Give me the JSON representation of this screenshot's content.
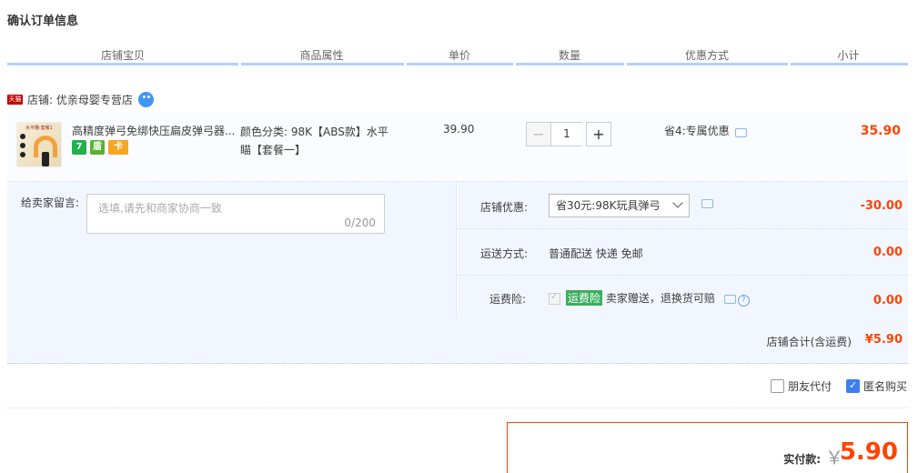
{
  "title": "确认订单信息",
  "columns": [
    "店铺宝贝",
    "商品属性",
    "单价",
    "数量",
    "优惠方式",
    "小计"
  ],
  "shop": {
    "badge": "天猫",
    "label": "店铺: 优亲母婴专营店"
  },
  "item": {
    "thumb_label": "水平瞄·套餐1",
    "title": "高精度弹弓免绑快压扁皮弹弓器...",
    "badges": [
      "7",
      "盾",
      "卡"
    ],
    "attr_line1": "颜色分类: 98K【ABS款】水平",
    "attr_line2": "瞄【套餐一】",
    "price": "39.90",
    "quantity": "1",
    "promo": "省4:专属优惠",
    "subtotal": "35.90"
  },
  "message": {
    "label": "给卖家留言:",
    "placeholder": "选填,请先和商家协商一致",
    "count": "0/200"
  },
  "shop_discount": {
    "label": "店铺优惠:",
    "selected": "省30元:98K玩具弹弓",
    "amount": "-30.00"
  },
  "shipping": {
    "label": "运送方式:",
    "text": "普通配送 快递 免邮",
    "amount": "0.00"
  },
  "insurance": {
    "label": "运费险:",
    "badge": "运费险",
    "text": "卖家赠送，退换货可赔",
    "help": "?",
    "amount": "0.00"
  },
  "shop_total": {
    "label": "店铺合计(含运费)",
    "amount": "¥5.90"
  },
  "options": {
    "friend_pay": "朋友代付",
    "anonymous": "匿名购买"
  },
  "payment": {
    "label": "实付款:",
    "currency": "￥",
    "amount": "5.90"
  },
  "colors": {
    "accent_red": "#ff4400",
    "header_rule": "#b2d1ff",
    "panel_bg": "#f2f7ff",
    "checkbox_blue": "#3d7ef0"
  }
}
